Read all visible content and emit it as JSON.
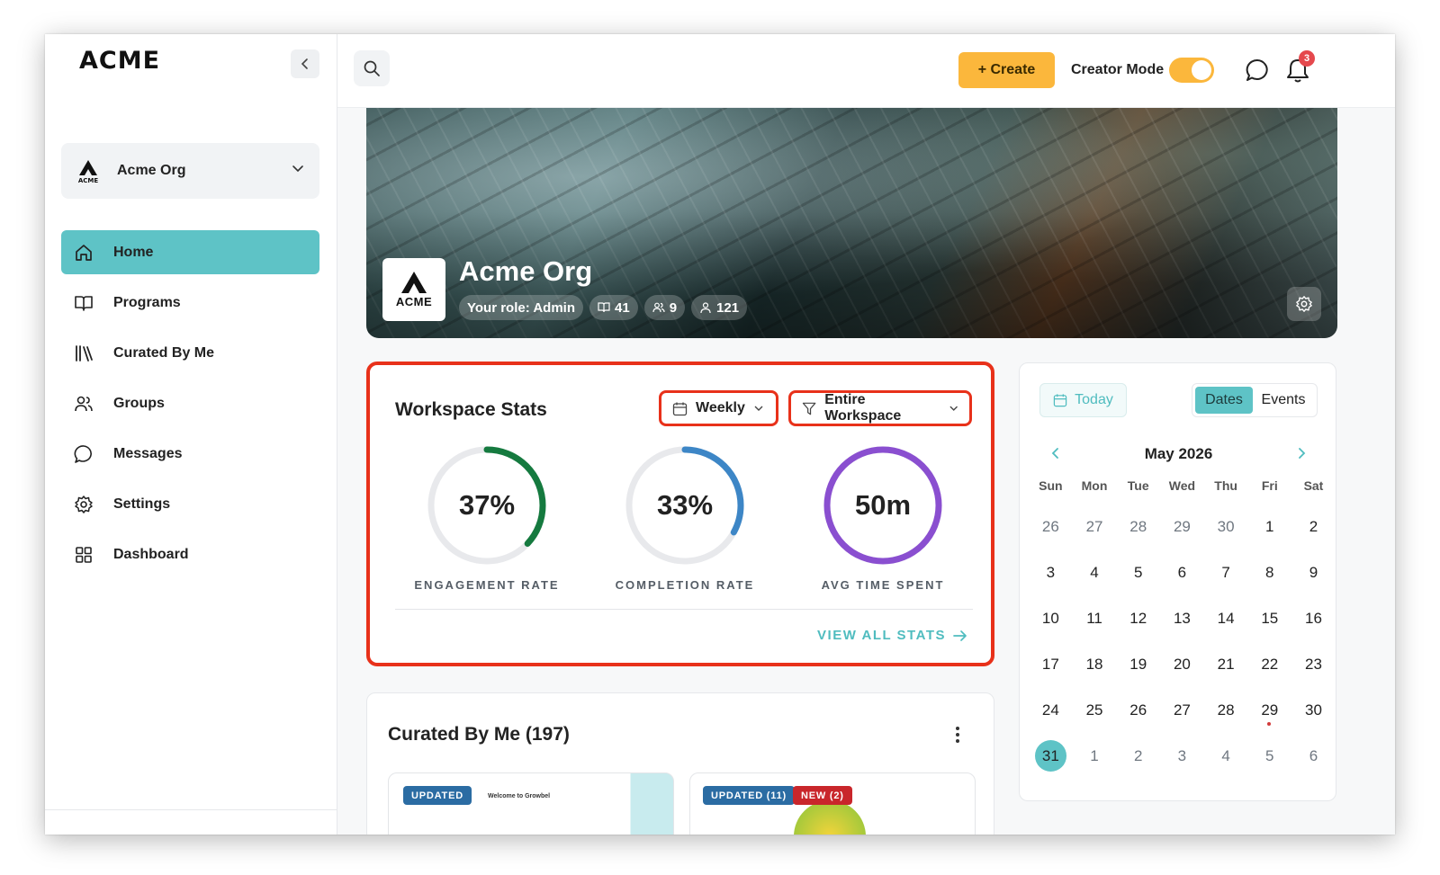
{
  "app": {
    "logo": "ACME"
  },
  "sidebar": {
    "org": {
      "mark_text": "ACME",
      "name": "Acme Org"
    },
    "items": [
      {
        "label": "Home",
        "icon": "home-icon",
        "active": true
      },
      {
        "label": "Programs",
        "icon": "book-icon",
        "active": false
      },
      {
        "label": "Curated By Me",
        "icon": "library-icon",
        "active": false
      },
      {
        "label": "Groups",
        "icon": "users-icon",
        "active": false
      },
      {
        "label": "Messages",
        "icon": "chat-icon",
        "active": false
      },
      {
        "label": "Settings",
        "icon": "gear-icon",
        "active": false
      },
      {
        "label": "Dashboard",
        "icon": "grid-icon",
        "active": false
      }
    ]
  },
  "topbar": {
    "create_label": "+ Create",
    "creator_mode_label": "Creator Mode",
    "creator_mode_on": true,
    "notification_count": "3"
  },
  "hero": {
    "logo_text": "ACME",
    "title": "Acme Org",
    "role": "Your role: Admin",
    "programs_count": "41",
    "groups_count": "9",
    "members_count": "121"
  },
  "stats": {
    "title": "Workspace Stats",
    "period": "Weekly",
    "scope": "Entire Workspace",
    "metrics": [
      {
        "value": "37%",
        "label": "ENGAGEMENT RATE",
        "progress": 0.37,
        "color": "#157a3f"
      },
      {
        "value": "33%",
        "label": "COMPLETION RATE",
        "progress": 0.33,
        "color": "#3d86c6"
      },
      {
        "value": "50m",
        "label": "AVG TIME SPENT",
        "progress": 1.0,
        "color": "#8a4fd0"
      }
    ],
    "view_all": "VIEW ALL STATS"
  },
  "calendar": {
    "today_label": "Today",
    "tabs": [
      "Dates",
      "Events"
    ],
    "active_tab": "Dates",
    "month": "May 2026",
    "weekdays": [
      "Sun",
      "Mon",
      "Tue",
      "Wed",
      "Thu",
      "Fri",
      "Sat"
    ],
    "weeks": [
      [
        "26",
        "27",
        "28",
        "29",
        "30",
        "1",
        "2"
      ],
      [
        "3",
        "4",
        "5",
        "6",
        "7",
        "8",
        "9"
      ],
      [
        "10",
        "11",
        "12",
        "13",
        "14",
        "15",
        "16"
      ],
      [
        "17",
        "18",
        "19",
        "20",
        "21",
        "22",
        "23"
      ],
      [
        "24",
        "25",
        "26",
        "27",
        "28",
        "29",
        "30"
      ],
      [
        "31",
        "1",
        "2",
        "3",
        "4",
        "5",
        "6"
      ]
    ],
    "selected": "31"
  },
  "curated": {
    "title": "Curated By Me (197)",
    "cards": [
      {
        "tags": [
          "UPDATED"
        ],
        "mini_text": "Welcome to Growbel"
      },
      {
        "tags": [
          "UPDATED (11)",
          "NEW (2)"
        ]
      }
    ]
  },
  "colors": {
    "accent": "#5ec3c6",
    "create": "#fbb73c",
    "highlight_border": "#e8311a"
  }
}
